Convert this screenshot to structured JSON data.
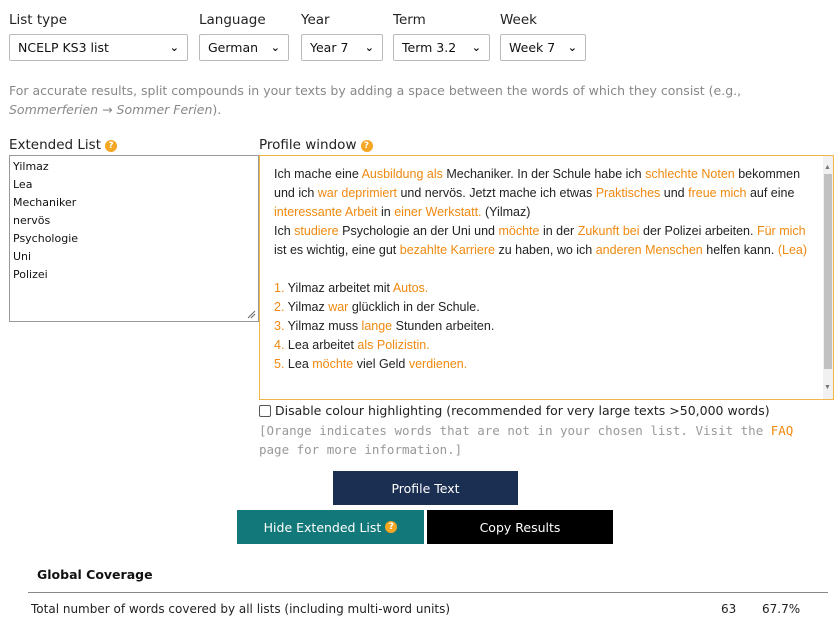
{
  "controls": {
    "list_type": {
      "label": "List type",
      "value": "NCELP KS3 list"
    },
    "language": {
      "label": "Language",
      "value": "German"
    },
    "year": {
      "label": "Year",
      "value": "Year 7"
    },
    "term": {
      "label": "Term",
      "value": "Term 3.2"
    },
    "week": {
      "label": "Week",
      "value": "Week 7"
    }
  },
  "compound_note": {
    "text": "For accurate results, split compounds in your texts by adding a space between the words of which they consist (e.g.,",
    "example_a": "Sommerferien",
    "arrow": "→",
    "example_b": "Sommer Ferien",
    "end": ")."
  },
  "extended_list": {
    "label": "Extended List",
    "items": [
      "Yilmaz",
      "Lea",
      "Mechaniker",
      "nervös",
      "Psychologie",
      "Uni",
      "Polizei"
    ]
  },
  "profile_window": {
    "label": "Profile window"
  },
  "disable_highlight": {
    "label": "Disable colour highlighting (recommended for very large texts >50,000 words)"
  },
  "orange_note": {
    "before": "[Orange indicates words that are not in your chosen list. Visit the",
    "link": "FAQ",
    "after": "page for more information.]"
  },
  "buttons": {
    "profile": "Profile Text",
    "hide_extended": "Hide Extended List",
    "copy": "Copy Results"
  },
  "global_coverage": {
    "title": "Global Coverage",
    "row_label": "Total number of words covered by all lists (including multi-word units)",
    "count": "63",
    "percent": "67.7%"
  },
  "colors": {
    "highlight": "#f0890f",
    "profile_button": "#1b2f52",
    "hide_button": "#13787a",
    "copy_button": "#000000",
    "info_icon": "#f5a623"
  }
}
